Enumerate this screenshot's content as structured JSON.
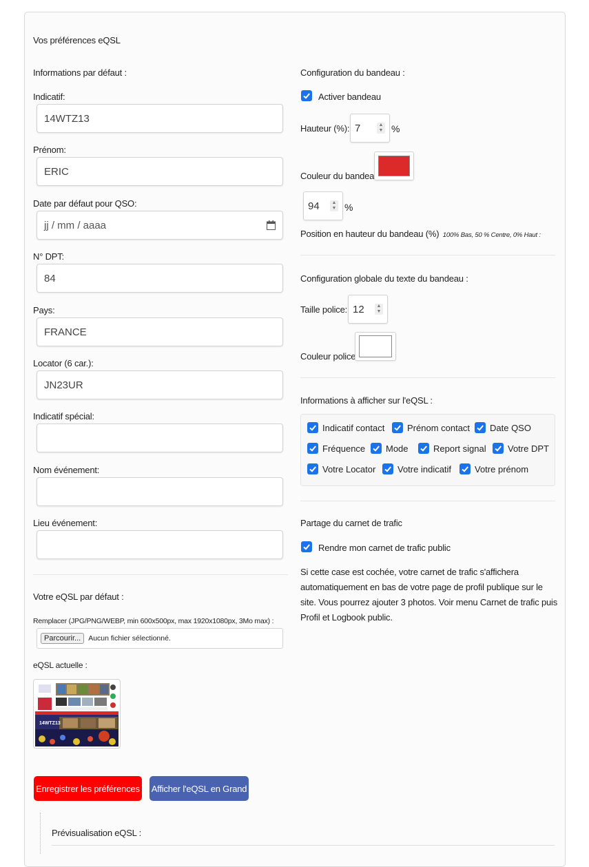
{
  "title": "Vos préférences eQSL",
  "left": {
    "section_title": "Informations par défaut :",
    "fields": {
      "indicatif_label": "Indicatif:",
      "indicatif_value": "14WTZ13",
      "prenom_label": "Prénom:",
      "prenom_value": "ERIC",
      "date_label": "Date par défaut pour QSO:",
      "date_placeholder": "jj / mm / aaaa",
      "dpt_label": "N° DPT:",
      "dpt_value": "84",
      "pays_label": "Pays:",
      "pays_value": "FRANCE",
      "locator_label": "Locator (6 car.):",
      "locator_value": "JN23UR",
      "special_label": "Indicatif spécial:",
      "special_value": "",
      "event_name_label": "Nom événement:",
      "event_name_value": "",
      "event_place_label": "Lieu événement:",
      "event_place_value": ""
    },
    "eqsl": {
      "title": "Votre eQSL par défaut :",
      "replace_label": "Remplacer (JPG/PNG/WEBP, min 600x500px, max 1920x1080px, 3Mo max) :",
      "file_button": "Parcourir...",
      "file_status": "Aucun fichier sélectionné.",
      "current_label": "eQSL actuelle :",
      "thumb_callsign": "14WTZ13"
    }
  },
  "right": {
    "banner": {
      "title": "Configuration du bandeau :",
      "activate_label": "Activer bandeau",
      "activate_checked": true,
      "height_label": "Hauteur (%):",
      "height_value": "7",
      "height_unit": "%",
      "color_label": "Couleur du bandeau:",
      "color_value": "#dc2a2a",
      "position_value": "94",
      "position_unit": "%",
      "position_label": "Position en hauteur du bandeau (%)",
      "position_hint": "100% Bas, 50 % Centre, 0% Haut :"
    },
    "text": {
      "title": "Configuration globale du texte du bandeau :",
      "size_label": "Taille police:",
      "size_value": "12",
      "color_label": "Couleur police:",
      "color_value": "#ffffff"
    },
    "display": {
      "title": "Informations à afficher sur l'eQSL :",
      "options": [
        "Indicatif contact",
        "Prénom contact",
        "Date QSO",
        "Fréquence",
        "Mode",
        "Report signal",
        "Votre DPT",
        "Votre Locator",
        "Votre indicatif",
        "Votre prénom"
      ]
    },
    "share": {
      "title": "Partage du carnet de trafic",
      "checkbox_label": "Rendre mon carnet de trafic public",
      "checked": true,
      "description": "Si cette case est cochée, votre carnet de trafic s'affichera automatiquement en bas de votre page de profil publique sur le site. Vous pourrez ajouter 3 photos. Voir menu Carnet de trafic puis Profil et Logbook public."
    }
  },
  "actions": {
    "save": "Enregistrer les préférences",
    "show_big": "Afficher l'eQSL en Grand"
  },
  "preview": {
    "label": "Prévisualisation eQSL :"
  },
  "colors": {
    "primary_check": "#1a73e8",
    "save_button": "#ff0000",
    "show_button": "#4a63b0",
    "banner_red": "#dc2a2a"
  }
}
